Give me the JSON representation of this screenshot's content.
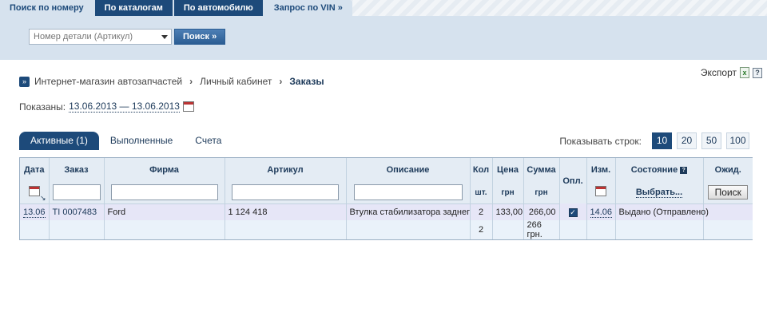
{
  "header": {
    "tabs": [
      "Поиск по номеру",
      "По каталогам",
      "По автомобилю",
      "Запрос по VIN »"
    ],
    "part_placeholder": "Номер детали (Артикул)",
    "search_label": "Поиск »"
  },
  "breadcrumb": {
    "items": [
      "Интернет-магазин автозапчастей",
      "Личный кабинет",
      "Заказы"
    ],
    "separator": "›"
  },
  "export_label": "Экспорт",
  "shown": {
    "label": "Показаны:",
    "dates": "13.06.2013 — 13.06.2013"
  },
  "subtabs": [
    "Активные (1)",
    "Выполненные",
    "Счета"
  ],
  "rows_per_page": {
    "label": "Показывать строк:",
    "options": [
      "10",
      "20",
      "50",
      "100"
    ],
    "selected": "10"
  },
  "table": {
    "columns": [
      "Дата",
      "Заказ",
      "Фирма",
      "Артикул",
      "Описание",
      "Кол",
      "Цена",
      "Сумма",
      "Опл.",
      "Изм.",
      "Состояние",
      "Ожид."
    ],
    "sub": {
      "qty": "шт.",
      "price": "грн",
      "sum": "грн",
      "choose": "Выбрать...",
      "find": "Поиск"
    },
    "rows": [
      {
        "date": "13.06",
        "order": "TI 0007483",
        "firm": "Ford",
        "article": "1 124 418",
        "description": "Втулка стабилизатора заднего",
        "qty": "2",
        "price": "133,00",
        "sum": "266,00",
        "paid": true,
        "changed": "14.06",
        "state": "Выдано (Отправлено)",
        "expected": ""
      }
    ],
    "total": {
      "qty": "2",
      "sum": "266 грн."
    }
  }
}
